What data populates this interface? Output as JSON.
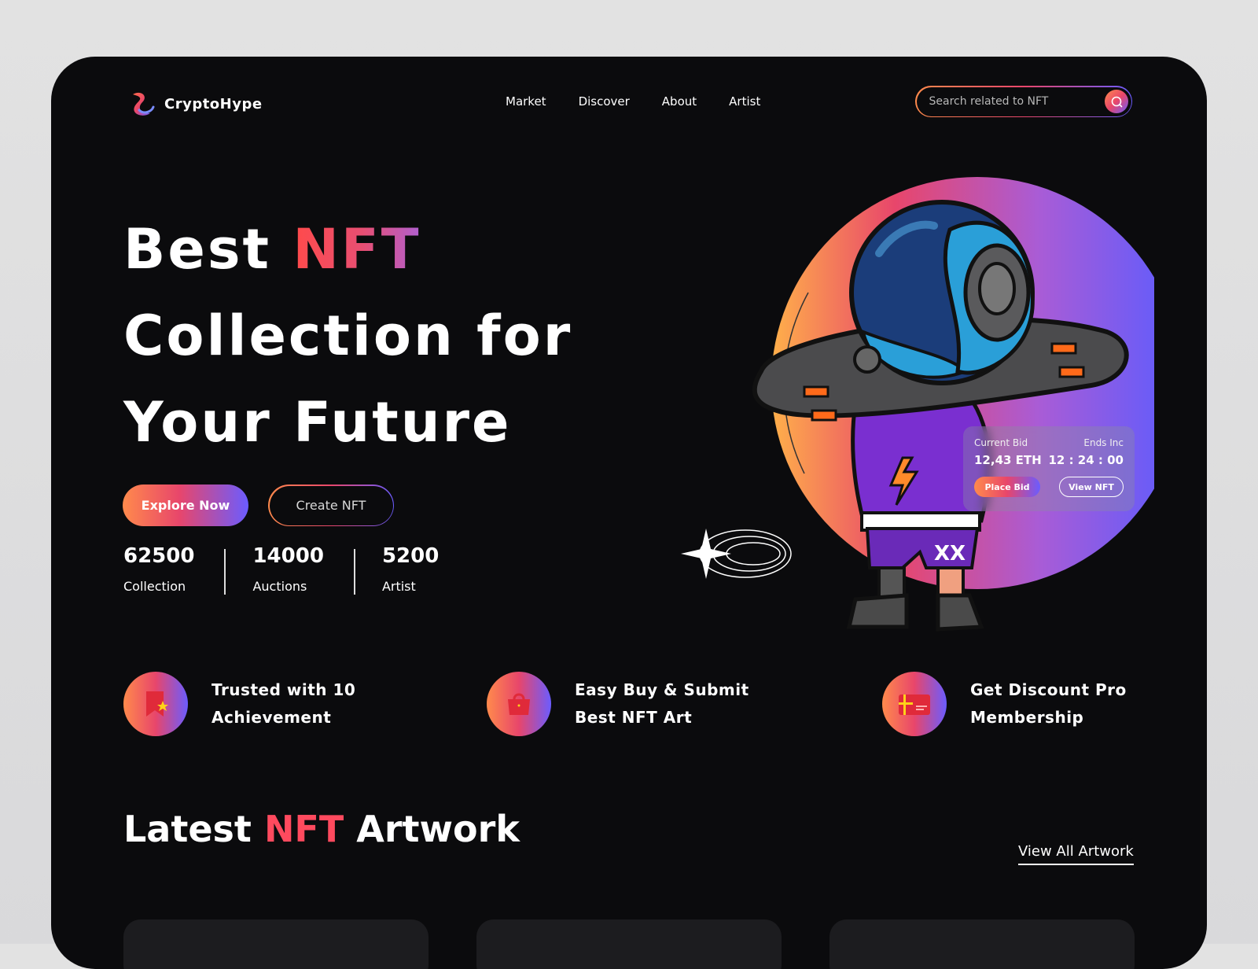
{
  "brand": {
    "name": "CryptoHype"
  },
  "nav": {
    "items": [
      "Market",
      "Discover",
      "About",
      "Artist"
    ]
  },
  "search": {
    "placeholder": "Search related to NFT"
  },
  "hero": {
    "title_prefix": "Best ",
    "title_accent": "NFT",
    "title_line2": "Collection for",
    "title_line3": "Your Future",
    "explore_label": "Explore Now",
    "create_label": "Create NFT"
  },
  "stats": [
    {
      "value": "62500",
      "label": "Collection"
    },
    {
      "value": "14000",
      "label": "Auctions"
    },
    {
      "value": "5200",
      "label": "Artist"
    }
  ],
  "bid": {
    "current_label": "Current Bid",
    "current_value": "12,43 ETH",
    "ends_label": "Ends Inc",
    "ends_value": "12 : 24 : 00",
    "place_label": "Place Bid",
    "view_label": "View NFT"
  },
  "features": [
    {
      "line1": "Trusted with 10",
      "line2": "Achievement",
      "icon": "bookmark-star-icon"
    },
    {
      "line1": "Easy Buy & Submit",
      "line2": "Best NFT Art",
      "icon": "shopping-bag-icon"
    },
    {
      "line1": "Get Discount Pro",
      "line2": "Membership",
      "icon": "ticket-card-icon"
    }
  ],
  "latest": {
    "title_prefix": "Latest ",
    "title_accent": "NFT",
    "title_suffix": " Artwork",
    "view_all_label": "View All Artwork"
  },
  "colors": {
    "background": "#0b0b0d",
    "gradient_start": "#ff8a4c",
    "gradient_mid": "#e8466b",
    "gradient_end": "#6b5cff",
    "accent_red": "#ff4a5e"
  }
}
